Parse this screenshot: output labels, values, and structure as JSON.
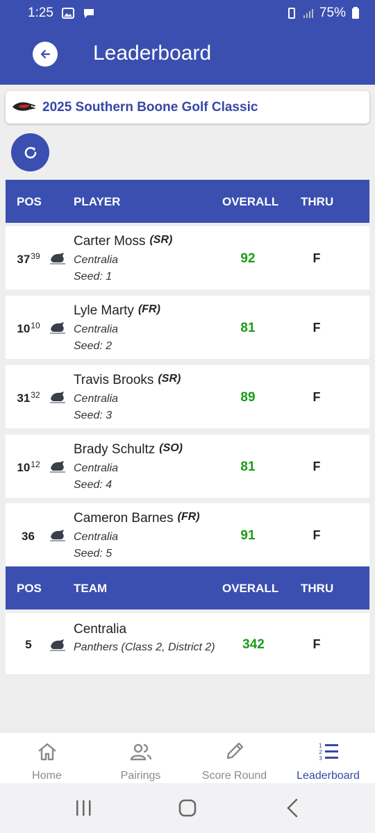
{
  "status_bar": {
    "time": "1:25",
    "battery": "75%"
  },
  "app_bar": {
    "title": "Leaderboard"
  },
  "event": {
    "name": "2025 Southern Boone Golf Classic"
  },
  "player_header": {
    "pos": "POS",
    "player": "PLAYER",
    "overall": "OVERALL",
    "thru": "THRU"
  },
  "players": [
    {
      "pos": "37",
      "pos_sup": "39",
      "name": "Carter Moss",
      "class": "(SR)",
      "team": "Centralia",
      "seed": "Seed: 1",
      "overall": "92",
      "thru": "F"
    },
    {
      "pos": "10",
      "pos_sup": "10",
      "name": "Lyle Marty",
      "class": "(FR)",
      "team": "Centralia",
      "seed": "Seed: 2",
      "overall": "81",
      "thru": "F"
    },
    {
      "pos": "31",
      "pos_sup": "32",
      "name": "Travis Brooks",
      "class": "(SR)",
      "team": "Centralia",
      "seed": "Seed: 3",
      "overall": "89",
      "thru": "F"
    },
    {
      "pos": "10",
      "pos_sup": "12",
      "name": "Brady Schultz",
      "class": "(SO)",
      "team": "Centralia",
      "seed": "Seed: 4",
      "overall": "81",
      "thru": "F"
    },
    {
      "pos": "36",
      "pos_sup": "",
      "name": "Cameron Barnes",
      "class": "(FR)",
      "team": "Centralia",
      "seed": "Seed: 5",
      "overall": "91",
      "thru": "F"
    }
  ],
  "team_header": {
    "pos": "POS",
    "team": "TEAM",
    "overall": "OVERALL",
    "thru": "THRU"
  },
  "teams": [
    {
      "pos": "5",
      "name": "Centralia",
      "desc": "Panthers (Class 2, District 2)",
      "overall": "342",
      "thru": "F"
    }
  ],
  "bottom_nav": [
    {
      "label": "Home",
      "icon": "home-icon"
    },
    {
      "label": "Pairings",
      "icon": "people-icon"
    },
    {
      "label": "Score Round",
      "icon": "pencil-icon"
    },
    {
      "label": "Leaderboard",
      "icon": "leaderboard-icon",
      "active": true
    }
  ],
  "colors": {
    "primary": "#3a4fb0",
    "score": "#1a9c1a",
    "background": "#eeeeef"
  }
}
